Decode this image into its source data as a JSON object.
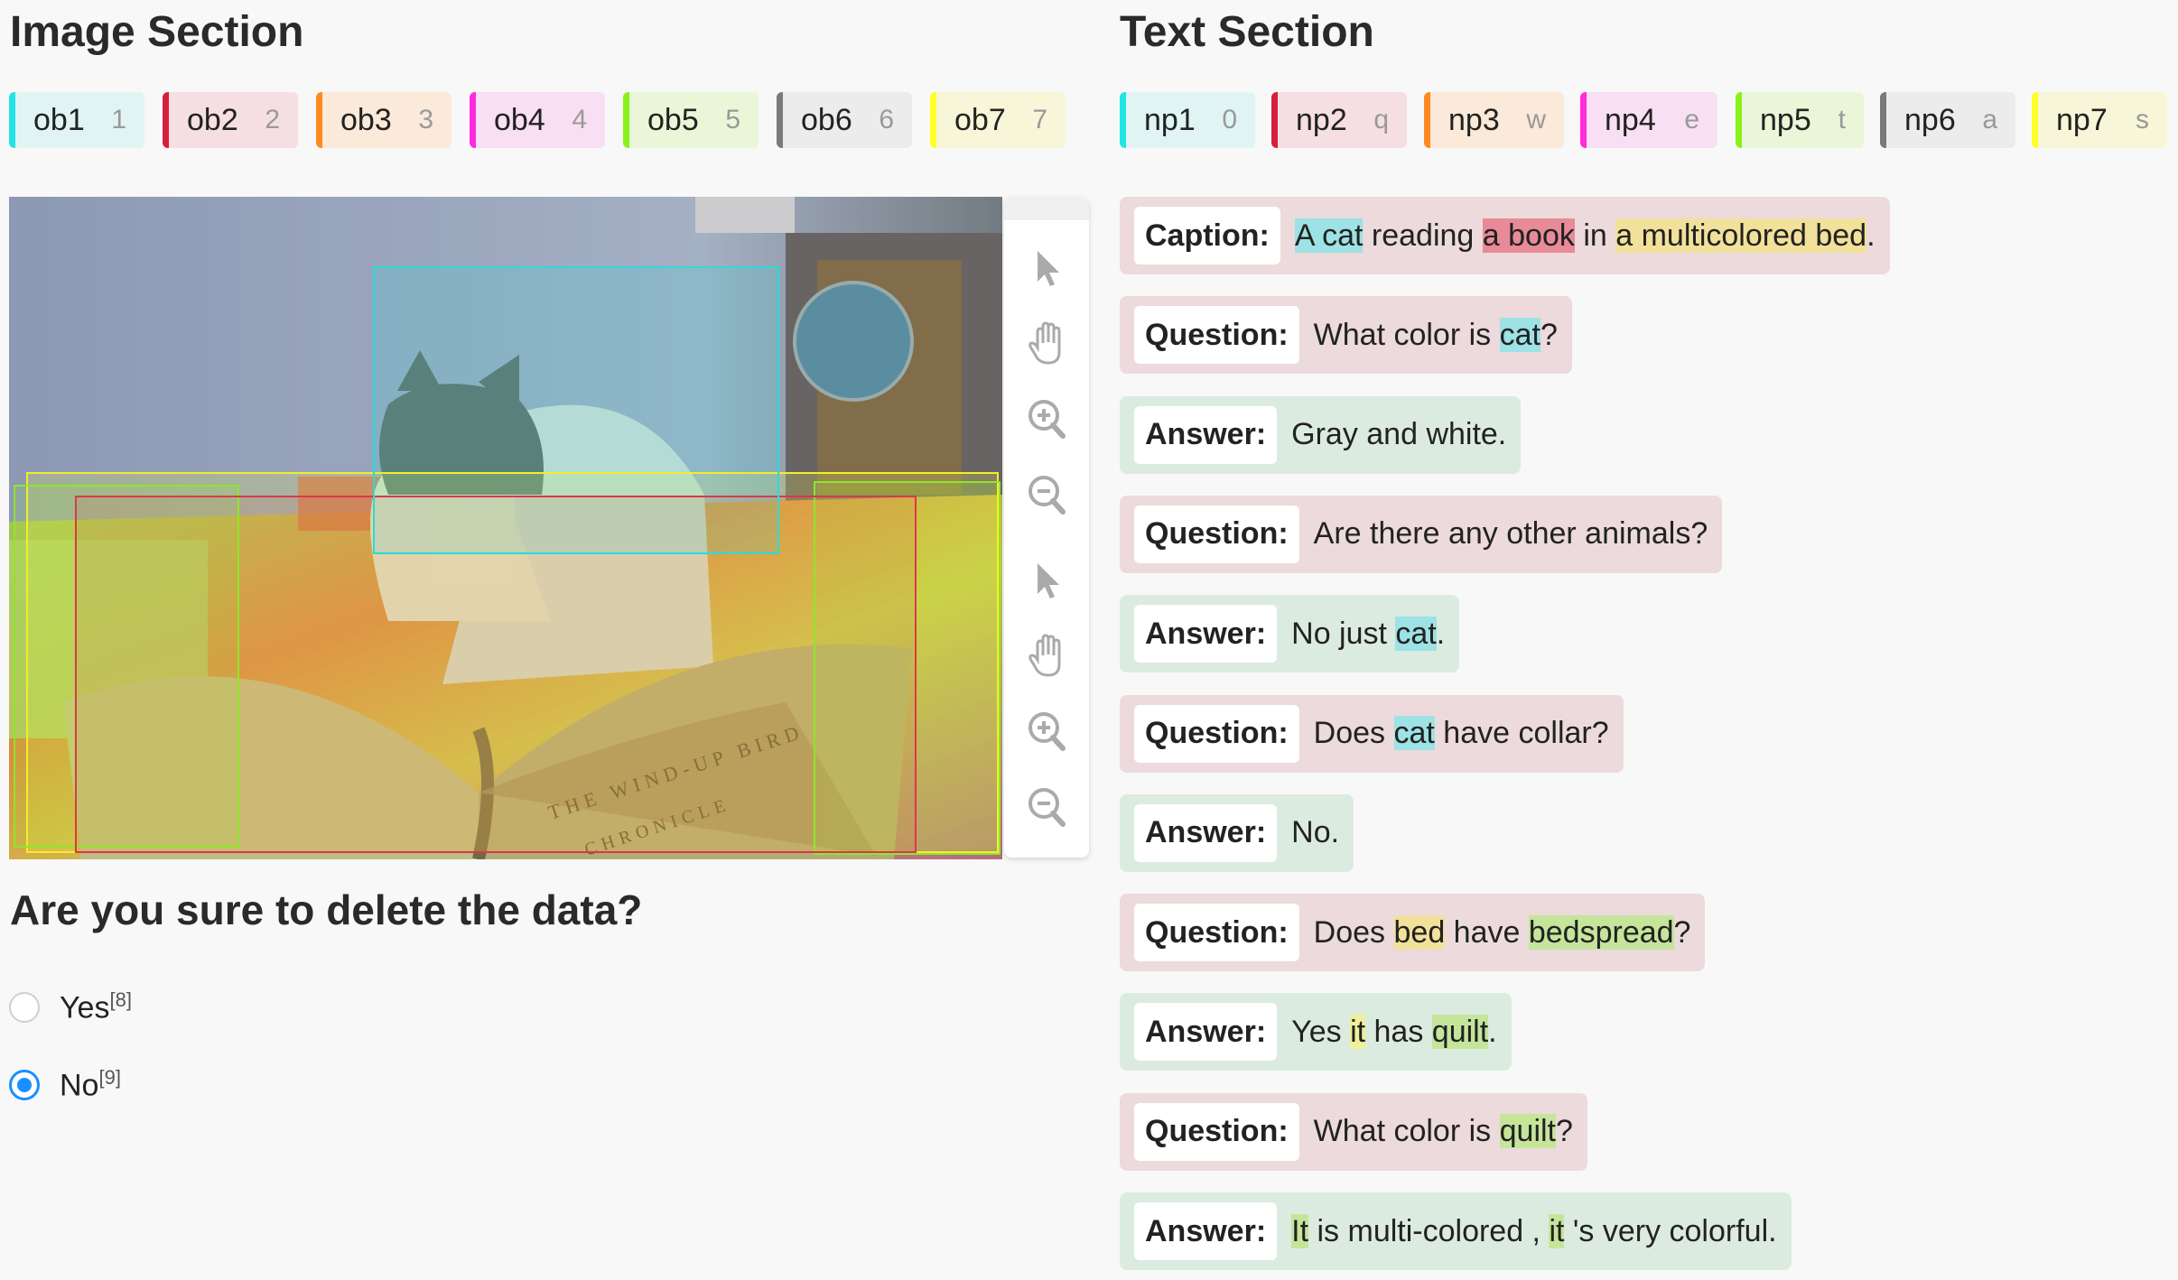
{
  "image_section": {
    "title": "Image Section",
    "labels": [
      {
        "name": "ob1",
        "hotkey": "1",
        "color": "#22e4e4",
        "bg": "#e0f4f4"
      },
      {
        "name": "ob2",
        "hotkey": "2",
        "color": "#d61f3c",
        "bg": "#f6dfe2"
      },
      {
        "name": "ob3",
        "hotkey": "3",
        "color": "#ff8a1f",
        "bg": "#fbe9d9"
      },
      {
        "name": "ob4",
        "hotkey": "4",
        "color": "#ff2bdc",
        "bg": "#f8dff3"
      },
      {
        "name": "ob5",
        "hotkey": "5",
        "color": "#88f21a",
        "bg": "#eaf6d8"
      },
      {
        "name": "ob6",
        "hotkey": "6",
        "color": "#7a7a7a",
        "bg": "#ececec"
      },
      {
        "name": "ob7",
        "hotkey": "7",
        "color": "#ffff26",
        "bg": "#f7f6d8"
      }
    ],
    "toolbar": [
      "pointer-icon",
      "hand-icon",
      "zoom-in-icon",
      "zoom-out-icon",
      "pointer-icon",
      "hand-icon",
      "zoom-in-icon",
      "zoom-out-icon"
    ],
    "photo_text": {
      "line1": "THE WIND-UP BIRD",
      "line2": "CHRONICLE"
    }
  },
  "delete_prompt": {
    "question": "Are you sure to delete the data?",
    "options": [
      {
        "label": "Yes",
        "hotkey": "[8]",
        "checked": false
      },
      {
        "label": "No",
        "hotkey": "[9]",
        "checked": true
      }
    ]
  },
  "text_section": {
    "title": "Text Section",
    "labels": [
      {
        "name": "np1",
        "hotkey": "0",
        "color": "#22e4e4",
        "bg": "#e0f4f4"
      },
      {
        "name": "np2",
        "hotkey": "q",
        "color": "#d61f3c",
        "bg": "#f6dfe2"
      },
      {
        "name": "np3",
        "hotkey": "w",
        "color": "#ff8a1f",
        "bg": "#fbe9d9"
      },
      {
        "name": "np4",
        "hotkey": "e",
        "color": "#ff2bdc",
        "bg": "#f8dff3"
      },
      {
        "name": "np5",
        "hotkey": "t",
        "color": "#88f21a",
        "bg": "#eaf6d8"
      },
      {
        "name": "np6",
        "hotkey": "a",
        "color": "#7a7a7a",
        "bg": "#ececec"
      },
      {
        "name": "np7",
        "hotkey": "s",
        "color": "#ffff26",
        "bg": "#f7f6d8"
      }
    ],
    "dialog": [
      {
        "type": "caption",
        "label": "Caption:",
        "segments": [
          {
            "t": "A cat",
            "hl": "cyan"
          },
          {
            "t": " reading "
          },
          {
            "t": "a book",
            "hl": "red"
          },
          {
            "t": " in "
          },
          {
            "t": "a multicolored bed",
            "hl": "yellow"
          },
          {
            "t": "."
          }
        ]
      },
      {
        "type": "question",
        "label": "Question:",
        "segments": [
          {
            "t": "What color is "
          },
          {
            "t": "cat",
            "hl": "cyan"
          },
          {
            "t": "?"
          }
        ]
      },
      {
        "type": "answer",
        "label": "Answer:",
        "segments": [
          {
            "t": "Gray and white."
          }
        ]
      },
      {
        "type": "question",
        "label": "Question:",
        "segments": [
          {
            "t": "Are there any other animals?"
          }
        ]
      },
      {
        "type": "answer",
        "label": "Answer:",
        "segments": [
          {
            "t": "No just "
          },
          {
            "t": "cat",
            "hl": "cyan"
          },
          {
            "t": "."
          }
        ]
      },
      {
        "type": "question",
        "label": "Question:",
        "segments": [
          {
            "t": "Does "
          },
          {
            "t": "cat",
            "hl": "cyan"
          },
          {
            "t": " have collar?"
          }
        ]
      },
      {
        "type": "answer",
        "label": "Answer:",
        "segments": [
          {
            "t": "No."
          }
        ]
      },
      {
        "type": "question",
        "label": "Question:",
        "segments": [
          {
            "t": "Does "
          },
          {
            "t": "bed",
            "hl": "yellow"
          },
          {
            "t": " have "
          },
          {
            "t": "bedspread",
            "hl": "green"
          },
          {
            "t": "?"
          }
        ]
      },
      {
        "type": "answer",
        "label": "Answer:",
        "segments": [
          {
            "t": "Yes "
          },
          {
            "t": "it",
            "hl": "ylw2"
          },
          {
            "t": " has "
          },
          {
            "t": "quilt",
            "hl": "green"
          },
          {
            "t": "."
          }
        ]
      },
      {
        "type": "question",
        "label": "Question:",
        "segments": [
          {
            "t": "What color is "
          },
          {
            "t": "quilt",
            "hl": "green"
          },
          {
            "t": "?"
          }
        ]
      },
      {
        "type": "answer",
        "label": "Answer:",
        "segments": [
          {
            "t": "It",
            "hl": "green"
          },
          {
            "t": " is multi-colored , "
          },
          {
            "t": "it",
            "hl": "green"
          },
          {
            "t": " 's very colorful."
          }
        ]
      }
    ]
  }
}
